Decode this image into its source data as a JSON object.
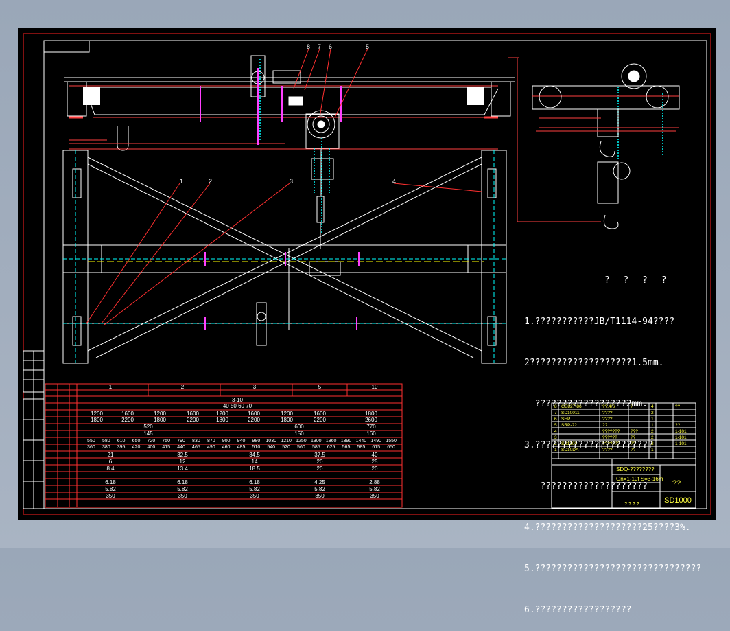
{
  "notes": {
    "title": "? ? ? ?",
    "lines": [
      "1.???????????JB/T1114-94????",
      "2???????????????????1.5mm.",
      "  ?????????????????2mm.",
      "3.??????????????????????",
      "   ????????????????????",
      "4.????????????????????25????3%.",
      "5.???????????????????????????????",
      "6.??????????????????"
    ]
  },
  "callouts": [
    "8",
    "7",
    "6",
    "5",
    "1",
    "2",
    "3",
    "4"
  ],
  "parts_list": {
    "rows": [
      [
        "8",
        "GB827-86",
        "??.4/6",
        "?",
        "4",
        "",
        "??"
      ],
      [
        "7",
        "SD10011",
        "????",
        "",
        "2",
        "",
        ""
      ],
      [
        "6",
        "SHP",
        "????",
        "",
        "1",
        "",
        ""
      ],
      [
        "5",
        "SRP-??",
        "??",
        "",
        "1",
        "",
        "??"
      ],
      [
        "4",
        "",
        "???????",
        "???",
        "2",
        "",
        "1-101"
      ],
      [
        "3",
        "",
        "??????",
        "??",
        "2",
        "",
        "1-101"
      ],
      [
        "2",
        "SS1200",
        "???????",
        "??",
        "2",
        "",
        "1-101"
      ],
      [
        "1",
        "SD10DA",
        "????",
        "??",
        "1",
        "",
        ""
      ]
    ]
  },
  "title_block": {
    "model": "SDQ-????????",
    "spec": "Gn=1-10t  S=3-16m",
    "name": "??",
    "drawing_no": "SD1000",
    "mark": "? ? ? ?"
  },
  "spec_table": {
    "row_ranges": [
      "3-10",
      "40  50  60  70"
    ],
    "groups": [
      "1",
      "2",
      "3",
      "5",
      "10"
    ],
    "row_a": [
      "1200",
      "1600",
      "1200",
      "1600",
      "1200",
      "1600",
      "1200",
      "1600",
      "1800"
    ],
    "row_b": [
      "1800",
      "2200",
      "1800",
      "2200",
      "1800",
      "2200",
      "1800",
      "2200",
      "2600"
    ],
    "row_c": [
      "520",
      "",
      "600",
      "770"
    ],
    "row_d": [
      "145",
      "",
      "150",
      "160"
    ],
    "row_e": [
      "550",
      "580",
      "610",
      "650",
      "720",
      "750",
      "790",
      "830",
      "870",
      "900",
      "940",
      "980",
      "1030",
      "1210",
      "1250",
      "1300",
      "1360",
      "1390",
      "1440",
      "1490",
      "1550"
    ],
    "row_f": [
      "360",
      "380",
      "395",
      "420",
      "400",
      "415",
      "440",
      "465",
      "490",
      "460",
      "485",
      "510",
      "540",
      "520",
      "560",
      "585",
      "625",
      "565",
      "585",
      "615",
      "650"
    ],
    "row_g": [
      "21",
      "32.5",
      "34.5",
      "37.5",
      "40"
    ],
    "row_h": [
      "6",
      "12",
      "14",
      "20",
      "25"
    ],
    "row_i": [
      "8.4",
      "13.4",
      "18.5",
      "20",
      "20"
    ],
    "row_j": [
      "6.18",
      "6.18",
      "6.18",
      "4.25",
      "2.88"
    ],
    "row_k": [
      "5.82",
      "5.82",
      "5.82",
      "5.82",
      "5.82"
    ],
    "row_l": [
      "350",
      "350",
      "350",
      "350",
      "350"
    ]
  }
}
